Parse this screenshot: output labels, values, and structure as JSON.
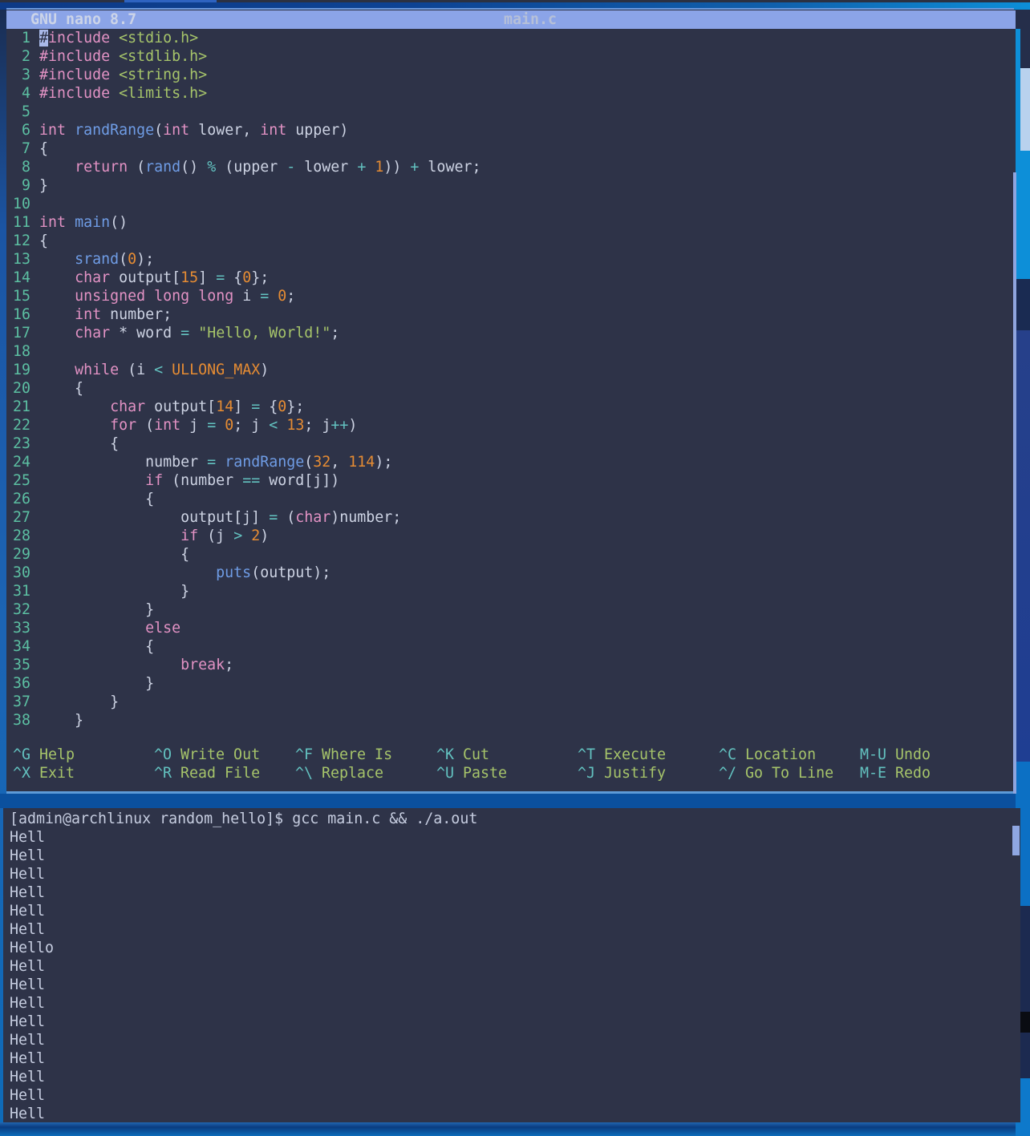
{
  "colors": {
    "bg": "#2e3348",
    "bar": "#8ba4e8",
    "bartext": "#ccd4e8",
    "barfile": "#b6c0d8",
    "fg": "#cdd3e3",
    "ln": "#5cbfa2",
    "kw": "#e292c4",
    "fn": "#6f9ce5",
    "num": "#e68c33",
    "str": "#a6c46a",
    "op": "#63c2c0",
    "cursor": "#a9b9e8",
    "term": "#c6cde0"
  },
  "editor": {
    "title_left": "GNU nano 8.7",
    "title_file": "main.c",
    "lines": [
      {
        "n": 1,
        "s": [
          [
            "cur",
            "#"
          ],
          [
            "kw",
            "include"
          ],
          [
            "t",
            " "
          ],
          [
            "str",
            "<stdio.h>"
          ]
        ]
      },
      {
        "n": 2,
        "s": [
          [
            "kw",
            "#include"
          ],
          [
            "t",
            " "
          ],
          [
            "str",
            "<stdlib.h>"
          ]
        ]
      },
      {
        "n": 3,
        "s": [
          [
            "kw",
            "#include"
          ],
          [
            "t",
            " "
          ],
          [
            "str",
            "<string.h>"
          ]
        ]
      },
      {
        "n": 4,
        "s": [
          [
            "kw",
            "#include"
          ],
          [
            "t",
            " "
          ],
          [
            "str",
            "<limits.h>"
          ]
        ]
      },
      {
        "n": 5,
        "s": []
      },
      {
        "n": 6,
        "s": [
          [
            "kw",
            "int"
          ],
          [
            "t",
            " "
          ],
          [
            "fn",
            "randRange"
          ],
          [
            "t",
            "("
          ],
          [
            "kw",
            "int"
          ],
          [
            "t",
            " lower, "
          ],
          [
            "kw",
            "int"
          ],
          [
            "t",
            " upper)"
          ]
        ]
      },
      {
        "n": 7,
        "s": [
          [
            "t",
            "{"
          ]
        ]
      },
      {
        "n": 8,
        "s": [
          [
            "t",
            "    "
          ],
          [
            "kw",
            "return"
          ],
          [
            "t",
            " ("
          ],
          [
            "fn",
            "rand"
          ],
          [
            "t",
            "() "
          ],
          [
            "op",
            "%"
          ],
          [
            "t",
            " (upper "
          ],
          [
            "op",
            "-"
          ],
          [
            "t",
            " lower "
          ],
          [
            "op",
            "+"
          ],
          [
            "t",
            " "
          ],
          [
            "num",
            "1"
          ],
          [
            "t",
            ")) "
          ],
          [
            "op",
            "+"
          ],
          [
            "t",
            " lower;"
          ]
        ]
      },
      {
        "n": 9,
        "s": [
          [
            "t",
            "}"
          ]
        ]
      },
      {
        "n": 10,
        "s": []
      },
      {
        "n": 11,
        "s": [
          [
            "kw",
            "int"
          ],
          [
            "t",
            " "
          ],
          [
            "fn",
            "main"
          ],
          [
            "t",
            "()"
          ]
        ]
      },
      {
        "n": 12,
        "s": [
          [
            "t",
            "{"
          ]
        ]
      },
      {
        "n": 13,
        "s": [
          [
            "t",
            "    "
          ],
          [
            "fn",
            "srand"
          ],
          [
            "t",
            "("
          ],
          [
            "num",
            "0"
          ],
          [
            "t",
            ");"
          ]
        ]
      },
      {
        "n": 14,
        "s": [
          [
            "t",
            "    "
          ],
          [
            "kw",
            "char"
          ],
          [
            "t",
            " output["
          ],
          [
            "num",
            "15"
          ],
          [
            "t",
            "] "
          ],
          [
            "op",
            "="
          ],
          [
            "t",
            " {"
          ],
          [
            "num",
            "0"
          ],
          [
            "t",
            "};"
          ]
        ]
      },
      {
        "n": 15,
        "s": [
          [
            "t",
            "    "
          ],
          [
            "kw",
            "unsigned"
          ],
          [
            "t",
            " "
          ],
          [
            "kw",
            "long"
          ],
          [
            "t",
            " "
          ],
          [
            "kw",
            "long"
          ],
          [
            "t",
            " i "
          ],
          [
            "op",
            "="
          ],
          [
            "t",
            " "
          ],
          [
            "num",
            "0"
          ],
          [
            "t",
            ";"
          ]
        ]
      },
      {
        "n": 16,
        "s": [
          [
            "t",
            "    "
          ],
          [
            "kw",
            "int"
          ],
          [
            "t",
            " number;"
          ]
        ]
      },
      {
        "n": 17,
        "s": [
          [
            "t",
            "    "
          ],
          [
            "kw",
            "char"
          ],
          [
            "t",
            " * word "
          ],
          [
            "op",
            "="
          ],
          [
            "t",
            " "
          ],
          [
            "str",
            "\"Hello, World!\""
          ],
          [
            "t",
            ";"
          ]
        ]
      },
      {
        "n": 18,
        "s": []
      },
      {
        "n": 19,
        "s": [
          [
            "t",
            "    "
          ],
          [
            "kw",
            "while"
          ],
          [
            "t",
            " (i "
          ],
          [
            "op",
            "<"
          ],
          [
            "t",
            " "
          ],
          [
            "num",
            "ULLONG_MAX"
          ],
          [
            "t",
            ")"
          ]
        ]
      },
      {
        "n": 20,
        "s": [
          [
            "t",
            "    {"
          ]
        ]
      },
      {
        "n": 21,
        "s": [
          [
            "t",
            "        "
          ],
          [
            "kw",
            "char"
          ],
          [
            "t",
            " output["
          ],
          [
            "num",
            "14"
          ],
          [
            "t",
            "] "
          ],
          [
            "op",
            "="
          ],
          [
            "t",
            " {"
          ],
          [
            "num",
            "0"
          ],
          [
            "t",
            "};"
          ]
        ]
      },
      {
        "n": 22,
        "s": [
          [
            "t",
            "        "
          ],
          [
            "kw",
            "for"
          ],
          [
            "t",
            " ("
          ],
          [
            "kw",
            "int"
          ],
          [
            "t",
            " j "
          ],
          [
            "op",
            "="
          ],
          [
            "t",
            " "
          ],
          [
            "num",
            "0"
          ],
          [
            "t",
            "; j "
          ],
          [
            "op",
            "<"
          ],
          [
            "t",
            " "
          ],
          [
            "num",
            "13"
          ],
          [
            "t",
            "; j"
          ],
          [
            "op",
            "++"
          ],
          [
            "t",
            ")"
          ]
        ]
      },
      {
        "n": 23,
        "s": [
          [
            "t",
            "        {"
          ]
        ]
      },
      {
        "n": 24,
        "s": [
          [
            "t",
            "            number "
          ],
          [
            "op",
            "="
          ],
          [
            "t",
            " "
          ],
          [
            "fn",
            "randRange"
          ],
          [
            "t",
            "("
          ],
          [
            "num",
            "32"
          ],
          [
            "t",
            ", "
          ],
          [
            "num",
            "114"
          ],
          [
            "t",
            ");"
          ]
        ]
      },
      {
        "n": 25,
        "s": [
          [
            "t",
            "            "
          ],
          [
            "kw",
            "if"
          ],
          [
            "t",
            " (number "
          ],
          [
            "op",
            "=="
          ],
          [
            "t",
            " word[j])"
          ]
        ]
      },
      {
        "n": 26,
        "s": [
          [
            "t",
            "            {"
          ]
        ]
      },
      {
        "n": 27,
        "s": [
          [
            "t",
            "                output[j] "
          ],
          [
            "op",
            "="
          ],
          [
            "t",
            " ("
          ],
          [
            "kw",
            "char"
          ],
          [
            "t",
            ")number;"
          ]
        ]
      },
      {
        "n": 28,
        "s": [
          [
            "t",
            "                "
          ],
          [
            "kw",
            "if"
          ],
          [
            "t",
            " (j "
          ],
          [
            "op",
            ">"
          ],
          [
            "t",
            " "
          ],
          [
            "num",
            "2"
          ],
          [
            "t",
            ")"
          ]
        ]
      },
      {
        "n": 29,
        "s": [
          [
            "t",
            "                {"
          ]
        ]
      },
      {
        "n": 30,
        "s": [
          [
            "t",
            "                    "
          ],
          [
            "fn",
            "puts"
          ],
          [
            "t",
            "(output);"
          ]
        ]
      },
      {
        "n": 31,
        "s": [
          [
            "t",
            "                }"
          ]
        ]
      },
      {
        "n": 32,
        "s": [
          [
            "t",
            "            }"
          ]
        ]
      },
      {
        "n": 33,
        "s": [
          [
            "t",
            "            "
          ],
          [
            "kw",
            "else"
          ]
        ]
      },
      {
        "n": 34,
        "s": [
          [
            "t",
            "            {"
          ]
        ]
      },
      {
        "n": 35,
        "s": [
          [
            "t",
            "                "
          ],
          [
            "kw",
            "break"
          ],
          [
            "t",
            ";"
          ]
        ]
      },
      {
        "n": 36,
        "s": [
          [
            "t",
            "            }"
          ]
        ]
      },
      {
        "n": 37,
        "s": [
          [
            "t",
            "        }"
          ]
        ]
      },
      {
        "n": 38,
        "s": [
          [
            "t",
            "    }"
          ]
        ]
      }
    ],
    "shortcuts": [
      [
        {
          "key": "^G",
          "label": "Help"
        },
        {
          "key": "^O",
          "label": "Write Out"
        },
        {
          "key": "^F",
          "label": "Where Is"
        },
        {
          "key": "^K",
          "label": "Cut"
        },
        {
          "key": "^T",
          "label": "Execute"
        },
        {
          "key": "^C",
          "label": "Location"
        },
        {
          "key": "M-U",
          "label": "Undo"
        }
      ],
      [
        {
          "key": "^X",
          "label": "Exit"
        },
        {
          "key": "^R",
          "label": "Read File"
        },
        {
          "key": "^\\",
          "label": "Replace"
        },
        {
          "key": "^U",
          "label": "Paste"
        },
        {
          "key": "^J",
          "label": "Justify"
        },
        {
          "key": "^/",
          "label": "Go To Line"
        },
        {
          "key": "M-E",
          "label": "Redo"
        }
      ]
    ]
  },
  "terminal": {
    "prompt": "[admin@archlinux random_hello]$ gcc main.c && ./a.out",
    "output_lines": [
      "Hell",
      "Hell",
      "Hell",
      "Hell",
      "Hell",
      "Hell",
      "Hello",
      "Hell",
      "Hell",
      "Hell",
      "Hell",
      "Hell",
      "Hell",
      "Hell",
      "Hell",
      "Hell"
    ]
  }
}
